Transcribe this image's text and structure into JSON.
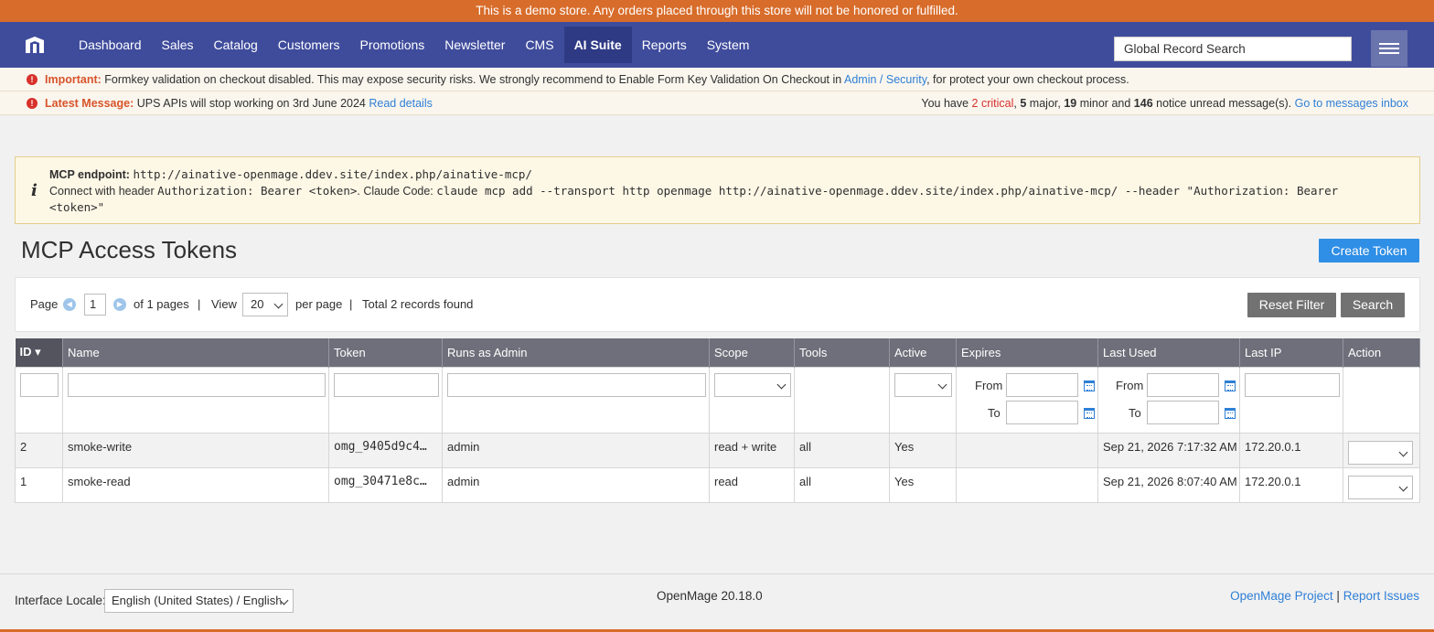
{
  "demo_notice": "This is a demo store. Any orders placed through this store will not be honored or fulfilled.",
  "nav": {
    "items": [
      {
        "label": "Dashboard"
      },
      {
        "label": "Sales"
      },
      {
        "label": "Catalog"
      },
      {
        "label": "Customers"
      },
      {
        "label": "Promotions"
      },
      {
        "label": "Newsletter"
      },
      {
        "label": "CMS"
      },
      {
        "label": "AI Suite",
        "active": true
      },
      {
        "label": "Reports"
      },
      {
        "label": "System"
      }
    ],
    "search_placeholder": "Global Record Search"
  },
  "messages": {
    "important_label": "Important:",
    "important_text": "Formkey validation on checkout disabled. This may expose security risks. We strongly recommend to Enable Form Key Validation On Checkout in",
    "important_link": "Admin / Security",
    "important_tail": ", for protect your own checkout process.",
    "latest_label": "Latest Message:",
    "latest_text": "UPS APIs will stop working on 3rd June 2024",
    "latest_link": "Read details",
    "summary_prefix": "You have",
    "critical_count": "2",
    "critical_label": "critical",
    "major_count": "5",
    "major_label": "major,",
    "minor_count": "19",
    "minor_label": "minor and",
    "notice_count": "146",
    "notice_label": "notice unread message(s).",
    "inbox_link": "Go to messages inbox"
  },
  "mcp_info": {
    "endpoint_label": "MCP endpoint:",
    "endpoint_url": "http://ainative-openmage.ddev.site/index.php/ainative-mcp/",
    "connect_text": "Connect with header",
    "header_value": "Authorization: Bearer <token>",
    "claude_label": ". Claude Code:",
    "claude_cmd_1": "claude mcp add --transport http openmage http://ainative-openmage.ddev.site/index.php/ainative-mcp/ --header \"Authorization: Bearer",
    "claude_cmd_2": "<token>\""
  },
  "page": {
    "title": "MCP Access Tokens",
    "create_button": "Create Token"
  },
  "pager": {
    "page_label": "Page",
    "page_value": "1",
    "of_pages": "of 1 pages",
    "sep": "|",
    "view_label": "View",
    "per_page_value": "20",
    "per_page_label": "per page",
    "total": "Total 2 records found",
    "reset_filter": "Reset Filter",
    "search": "Search"
  },
  "grid": {
    "columns": [
      "ID",
      "Name",
      "Token",
      "Runs as Admin",
      "Scope",
      "Tools",
      "Active",
      "Expires",
      "Last Used",
      "Last IP",
      "Action"
    ],
    "from_label": "From",
    "to_label": "To",
    "rows": [
      {
        "id": "2",
        "name": "smoke-write",
        "token": "omg_9405d9c4…",
        "admin": "admin",
        "scope": "read + write",
        "tools": "all",
        "active": "Yes",
        "expires": "",
        "last_used": "Sep 21, 2026 7:17:32 AM",
        "last_ip": "172.20.0.1"
      },
      {
        "id": "1",
        "name": "smoke-read",
        "token": "omg_30471e8c…",
        "admin": "admin",
        "scope": "read",
        "tools": "all",
        "active": "Yes",
        "expires": "",
        "last_used": "Sep 21, 2026 8:07:40 AM",
        "last_ip": "172.20.0.1"
      }
    ]
  },
  "footer": {
    "locale_label": "Interface Locale:",
    "locale_value": "English (United States) / English",
    "version": "OpenMage 20.18.0",
    "project_link": "OpenMage Project",
    "sep": "|",
    "issues_link": "Report Issues"
  },
  "colors": {
    "demo_bar": "#d86c2a",
    "nav_bg": "#3f4c9c",
    "accent_button": "#2f8ee5",
    "grid_header": "#6f6f7b",
    "critical": "#d8302b"
  }
}
